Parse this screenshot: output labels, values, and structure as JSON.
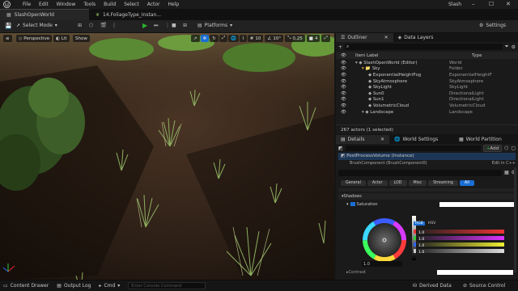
{
  "titlebar": {
    "menu": [
      "File",
      "Edit",
      "Window",
      "Tools",
      "Build",
      "Select",
      "Actor",
      "Help"
    ],
    "project": "Slash",
    "colors": {
      "background": "#1b1b1b"
    }
  },
  "tabs": [
    {
      "label": "SlashOpenWorld",
      "icon": "level-icon"
    },
    {
      "label": "14.FoliageType_Instan...",
      "icon": "foliage-icon"
    }
  ],
  "toolbar": {
    "select_mode": "Select Mode",
    "platforms": "Platforms",
    "settings": "Settings"
  },
  "viewport": {
    "perspective": "Perspective",
    "lit": "Lit",
    "show": "Show",
    "snap_values": [
      "10",
      "10°",
      "0.25"
    ],
    "camera_speed": "4"
  },
  "outliner": {
    "tabs": [
      "Outliner",
      "Data Layers"
    ],
    "columns": {
      "label": "Item Label",
      "type": "Type"
    },
    "rows": [
      {
        "label": "SlashOpenWorld (Editor)",
        "type": "World",
        "depth": 0
      },
      {
        "label": "Sky",
        "type": "Folder",
        "depth": 1
      },
      {
        "label": "ExponentialHeightFog",
        "type": "ExponentialHeightF",
        "depth": 2
      },
      {
        "label": "SkyAtmosphere",
        "type": "SkyAtmosphere",
        "depth": 2
      },
      {
        "label": "SkyLight",
        "type": "SkyLight",
        "depth": 2
      },
      {
        "label": "Sun0",
        "type": "DirectionalLight",
        "depth": 2
      },
      {
        "label": "Sun1",
        "type": "DirectionalLight",
        "depth": 2
      },
      {
        "label": "VolumetricCloud",
        "type": "VolumetricCloud",
        "depth": 2
      },
      {
        "label": "Landscape",
        "type": "Landscape",
        "depth": 1
      }
    ],
    "status": "267 actors (1 selected)"
  },
  "details": {
    "tabs": [
      "Details",
      "World Settings",
      "World Partition"
    ],
    "add_label": "Add",
    "selected_actor": "PostProcessVolume (Instance)",
    "component": "BrushComponent (BrushComponent0)",
    "edit_in": "Edit in C++",
    "filters": [
      "General",
      "Actor",
      "LOD",
      "Misc",
      "Streaming",
      "All"
    ],
    "active_filter": "All",
    "section": "Shadows",
    "property": "Saturation",
    "color_mode": [
      "RGB",
      "HSV"
    ],
    "wheel_value": "1.0",
    "slider_values": [
      "1.0",
      "1.0",
      "1.0",
      "1.0"
    ],
    "contrast": "Contrast"
  },
  "statusbar": {
    "content_drawer": "Content Drawer",
    "output_log": "Output Log",
    "cmd": "Cmd",
    "console_placeholder": "Enter Console Command",
    "derived_data": "Derived Data",
    "source_control": "Source Control"
  },
  "colors": {
    "accent": "#1a6fd6",
    "play_green": "#2fb52f",
    "selection": "#1d3656"
  }
}
